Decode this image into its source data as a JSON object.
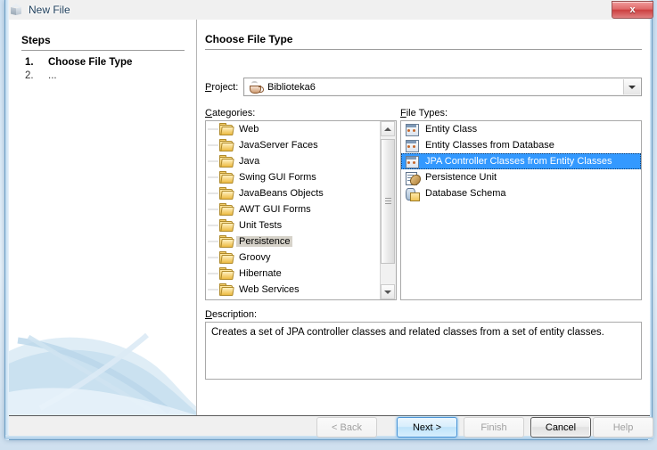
{
  "window": {
    "title": "New File",
    "icon": "cube-icon",
    "close_label": "x"
  },
  "steps": {
    "heading": "Steps",
    "items": [
      {
        "num": "1.",
        "label": "Choose File Type"
      },
      {
        "num": "2.",
        "label": "..."
      }
    ]
  },
  "content": {
    "heading": "Choose File Type",
    "project": {
      "label": "Project:",
      "value": "Biblioteka6",
      "icon": "java-coffee-cup-icon"
    },
    "categories": {
      "label": "Categories:",
      "selected": "Persistence",
      "items": [
        "Web",
        "JavaServer Faces",
        "Java",
        "Swing GUI Forms",
        "JavaBeans Objects",
        "AWT GUI Forms",
        "Unit Tests",
        "Persistence",
        "Groovy",
        "Hibernate",
        "Web Services"
      ]
    },
    "file_types": {
      "label": "File Types:",
      "selected": "JPA Controller Classes from Entity Classes",
      "items": [
        {
          "label": "Entity Class",
          "icon": "entity-class-icon"
        },
        {
          "label": "Entity Classes from Database",
          "icon": "entity-class-icon"
        },
        {
          "label": "JPA Controller Classes from Entity Classes",
          "icon": "entity-class-icon"
        },
        {
          "label": "Persistence Unit",
          "icon": "persistence-unit-icon"
        },
        {
          "label": "Database Schema",
          "icon": "database-schema-icon"
        }
      ]
    },
    "description": {
      "label": "Description:",
      "text": "Creates a set of JPA controller classes and related classes from a set of entity classes."
    }
  },
  "buttons": {
    "back": "< Back",
    "next": "Next >",
    "finish": "Finish",
    "cancel": "Cancel",
    "help": "Help"
  },
  "colors": {
    "selection_blue": "#3399ff",
    "selection_gray": "#d6d2c9",
    "dialog_bg": "#f0f0f0",
    "close_red": "#cc4040"
  }
}
